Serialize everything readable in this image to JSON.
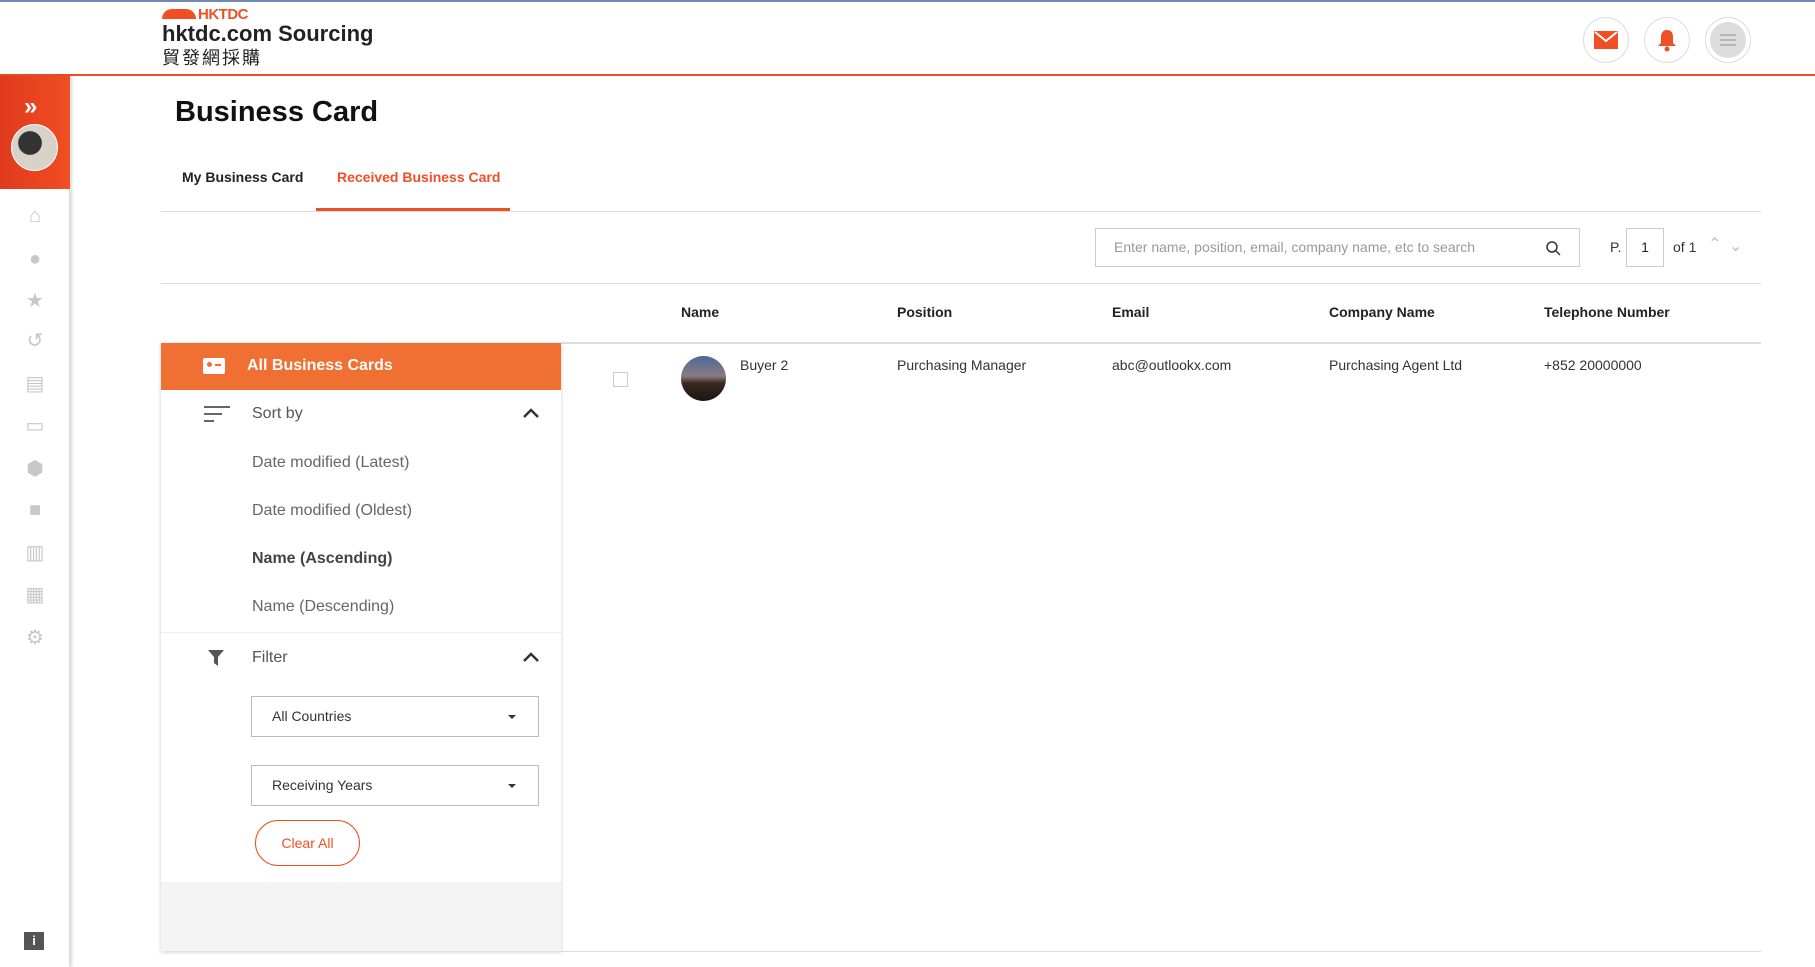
{
  "header": {
    "logo_brand": "HKTDC",
    "logo_title": "hktdc.com Sourcing",
    "logo_cn": "貿發網採購",
    "icons": [
      "mail-icon",
      "bell-icon",
      "menu-icon"
    ]
  },
  "colors": {
    "accent": "#f04e23",
    "orange_bar": "#f07033"
  },
  "sidebar": {
    "icons": [
      "home-icon",
      "user-icon",
      "star-icon",
      "history-icon",
      "message-icon",
      "business-card-icon",
      "product-box-icon",
      "shopping-bag-icon",
      "checklist-icon",
      "briefcase-chart-icon",
      "user-settings-icon"
    ],
    "info_icon": "info-icon"
  },
  "page": {
    "title": "Business Card"
  },
  "tabs": [
    {
      "label": "My Business Card",
      "active": false
    },
    {
      "label": "Received Business Card",
      "active": true
    }
  ],
  "search": {
    "placeholder": "Enter name, position, email, company name, etc to search"
  },
  "pagination": {
    "prefix": "P.",
    "current": "1",
    "of_label": "of 1"
  },
  "left_panel": {
    "all_label": "All Business Cards",
    "sort_label": "Sort by",
    "sort_options": [
      "Date modified (Latest)",
      "Date modified (Oldest)",
      "Name (Ascending)",
      "Name (Descending)"
    ],
    "sort_selected": "Name (Ascending)",
    "filter_label": "Filter",
    "country_select": "All Countries",
    "years_select": "Receiving Years",
    "clear_label": "Clear All"
  },
  "table": {
    "headers": [
      "Name",
      "Position",
      "Email",
      "Company Name",
      "Telephone Number"
    ],
    "rows": [
      {
        "name": "Buyer 2",
        "position": "Purchasing Manager",
        "email": "abc@outlookx.com",
        "company": "Purchasing Agent Ltd",
        "phone": "+852 20000000",
        "checked": false
      }
    ]
  }
}
